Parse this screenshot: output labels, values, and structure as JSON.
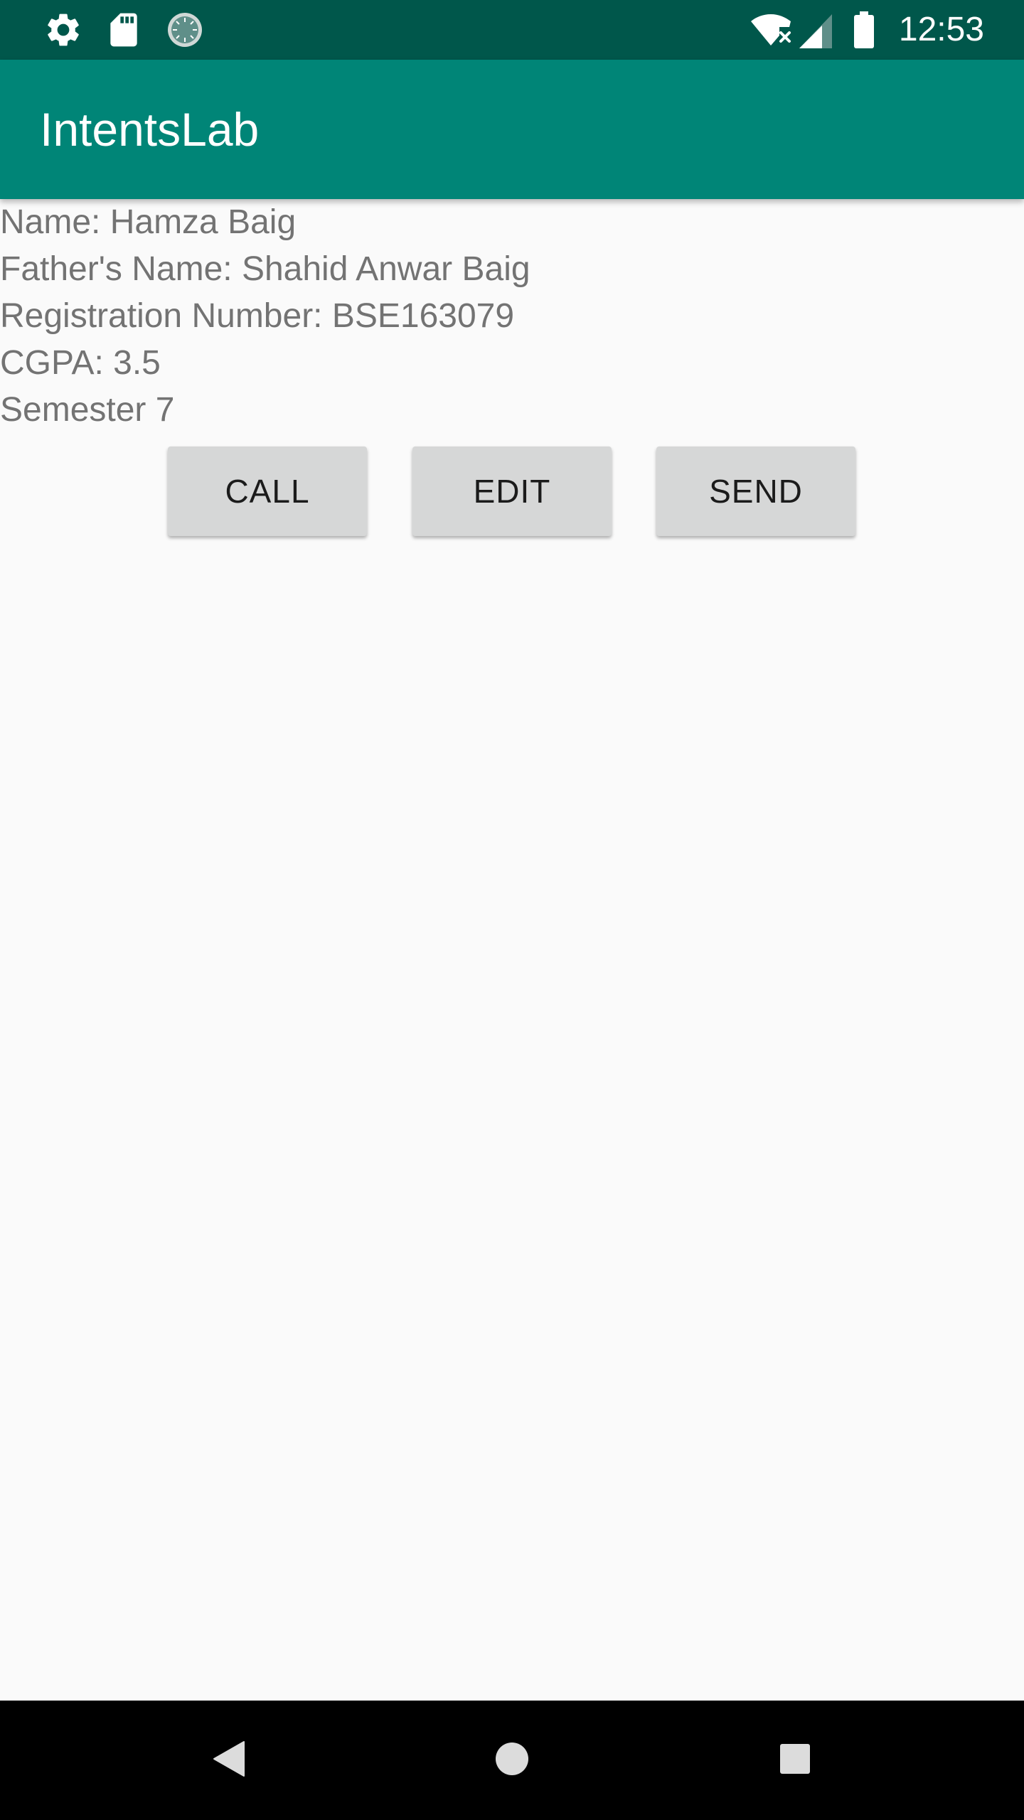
{
  "status_bar": {
    "time": "12:53",
    "left_icons": [
      "gear-icon",
      "sd-card-icon",
      "sync-progress-icon"
    ],
    "right_icons": [
      "wifi-off-icon",
      "cell-signal-icon",
      "battery-icon"
    ],
    "background": "#00574b"
  },
  "app_bar": {
    "title": "IntentsLab",
    "background": "#008577"
  },
  "info": {
    "name": "Name: Hamza Baig",
    "father_name": "Father's Name: Shahid Anwar Baig",
    "registration": "Registration Number: BSE163079",
    "cgpa": "CGPA: 3.5",
    "semester": "Semester 7"
  },
  "buttons": {
    "call": "CALL",
    "edit": "EDIT",
    "send": "SEND",
    "background": "#d6d7d7"
  },
  "nav_bar": {
    "icons": [
      "back-icon",
      "home-icon",
      "recents-icon"
    ]
  }
}
